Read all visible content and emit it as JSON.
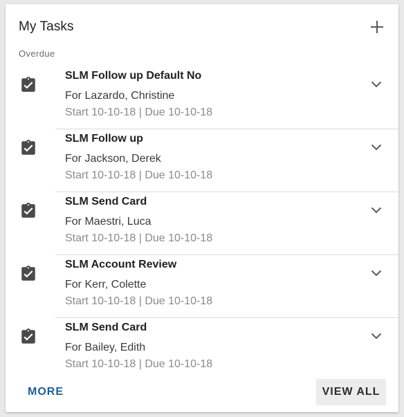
{
  "header": {
    "title": "My Tasks",
    "add_icon": "plus-icon"
  },
  "section": {
    "label": "Overdue"
  },
  "tasks": [
    {
      "title": "SLM Follow up Default No",
      "for": "For Lazardo, Christine",
      "dates": "Start 10-10-18 | Due 10-10-18",
      "icon": "clipboard-check-icon"
    },
    {
      "title": "SLM Follow up",
      "for": "For Jackson, Derek",
      "dates": "Start 10-10-18 | Due 10-10-18",
      "icon": "clipboard-check-icon"
    },
    {
      "title": "SLM Send Card",
      "for": "For Maestri, Luca",
      "dates": "Start 10-10-18 | Due 10-10-18",
      "icon": "clipboard-check-icon"
    },
    {
      "title": "SLM Account Review",
      "for": "For Kerr, Colette",
      "dates": "Start 10-10-18 | Due 10-10-18",
      "icon": "clipboard-check-icon"
    },
    {
      "title": "SLM Send Card",
      "for": "For Bailey, Edith",
      "dates": "Start 10-10-18 | Due 10-10-18",
      "icon": "clipboard-check-icon"
    }
  ],
  "footer": {
    "more_label": "MORE",
    "view_all_label": "VIEW ALL"
  },
  "colors": {
    "link": "#1a5f9c",
    "icon": "#4a4a4a",
    "muted": "#8a8a8a"
  }
}
